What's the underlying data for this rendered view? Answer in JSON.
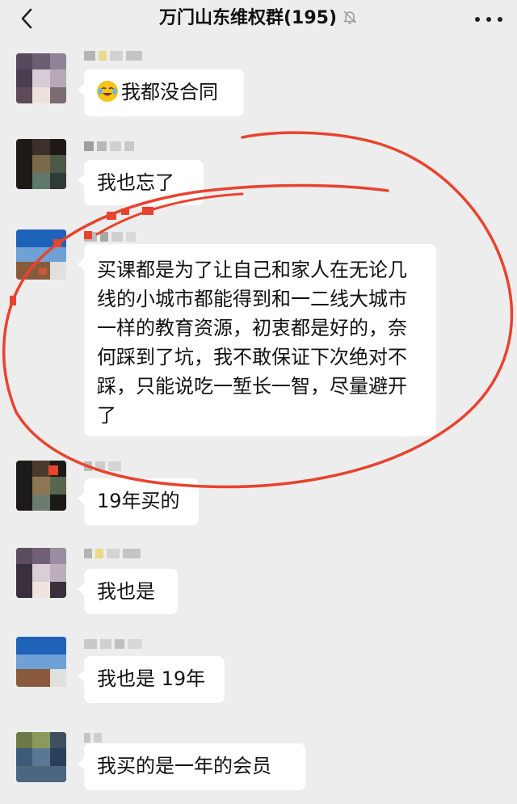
{
  "header": {
    "title": "万门山东维权群(195)",
    "back_icon": "back-chevron-icon",
    "mute_icon": "bell-muted-icon",
    "more_icon": "more-dots-icon"
  },
  "messages": [
    {
      "text": "我都没合同",
      "emoji": "crying-laughing-emoji"
    },
    {
      "text": "我也忘了"
    },
    {
      "text": "买课都是为了让自己和家人在无论几线的小城市都能得到和一二线大城市一样的教育资源，初衷都是好的，奈何踩到了坑，我不敢保证下次绝对不踩，只能说吃一堑长一智，尽量避开了"
    },
    {
      "text": "19年买的"
    },
    {
      "text": "我也是"
    },
    {
      "text": "我也是 19年"
    },
    {
      "text": "我买的是一年的会员"
    }
  ],
  "colors": {
    "background": "#ededed",
    "bubble": "#ffffff",
    "annotation_red": "#e8432e"
  }
}
